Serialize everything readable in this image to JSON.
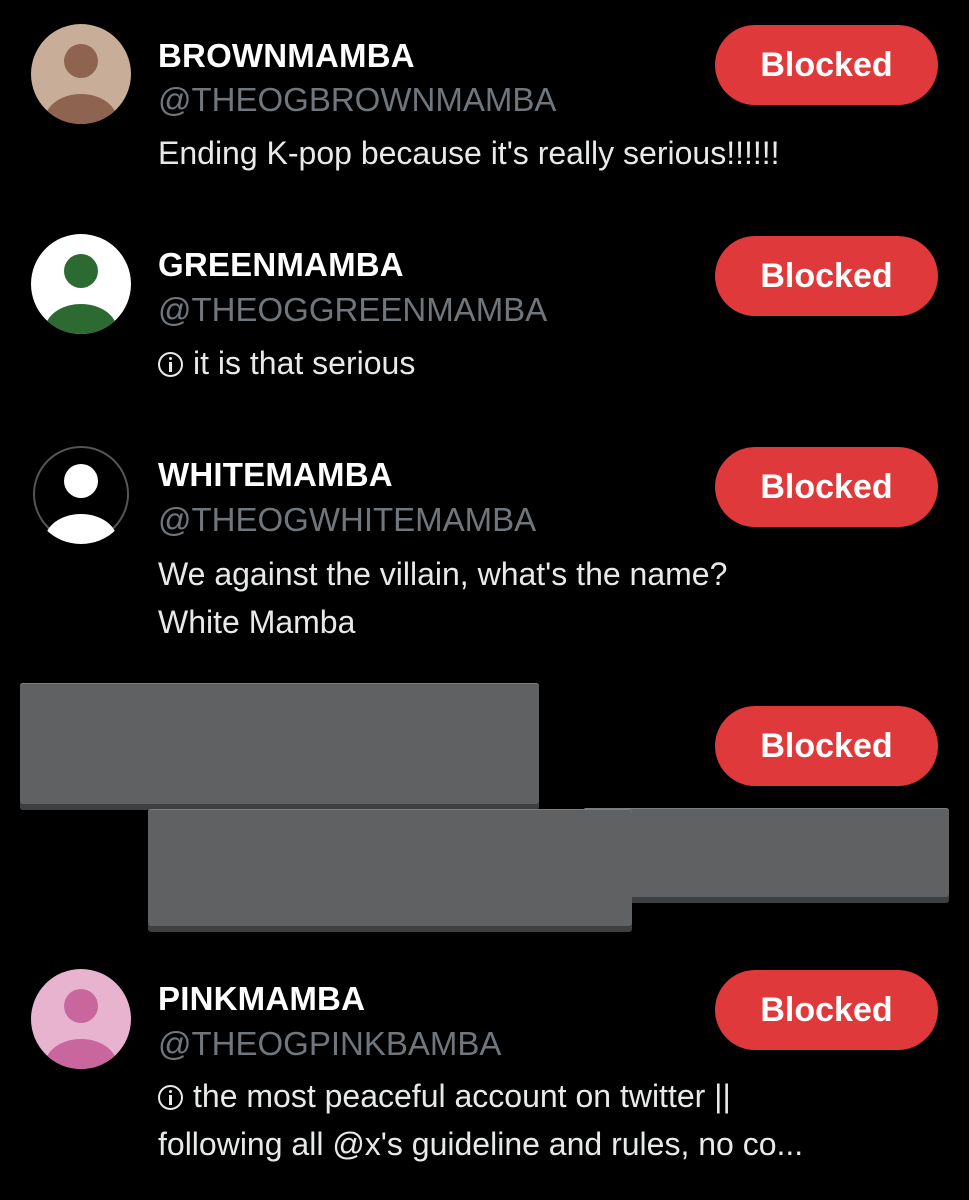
{
  "colors": {
    "background": "#000000",
    "blocked_button": "#e0393b",
    "handle_text": "#6f767c",
    "cover_block": "#606162"
  },
  "accounts": [
    {
      "name": "BROWNMAMBA",
      "handle": "@THEOGBROWNMAMBA",
      "bio_lines": [
        "Ending K-pop because it's really serious!!!!!!"
      ],
      "bio_icon": "",
      "avatar_bg": "#c8ae98",
      "avatar_fg": "#8e6450",
      "button_label": "Blocked"
    },
    {
      "name": "GREENMAMBA",
      "handle": "@THEOGGREENMAMBA",
      "bio_lines": [
        "it is that serious"
      ],
      "bio_icon": "info-icon",
      "avatar_bg": "#ffffff",
      "avatar_fg": "#2d6a31",
      "button_label": "Blocked"
    },
    {
      "name": "WHITEMAMBA",
      "handle": "@THEOGWHITEMAMBA",
      "bio_lines": [
        "We against the villain, what's the name?",
        "White Mamba"
      ],
      "bio_icon": "",
      "avatar_bg": "#000000",
      "avatar_fg": "#ffffff",
      "button_label": "Blocked"
    },
    {
      "name": "",
      "handle": "",
      "bio_lines": [],
      "bio_icon": "",
      "button_label": "Blocked",
      "covered": true
    },
    {
      "name": "PINKMAMBA",
      "handle": "@THEOGPINKBAMBA",
      "bio_lines": [
        "the most peaceful account on twitter ||",
        "following all @x's guideline and rules, no co..."
      ],
      "bio_icon": "info-icon",
      "avatar_bg": "#e7b3cf",
      "avatar_fg": "#c9669d",
      "button_label": "Blocked"
    }
  ]
}
